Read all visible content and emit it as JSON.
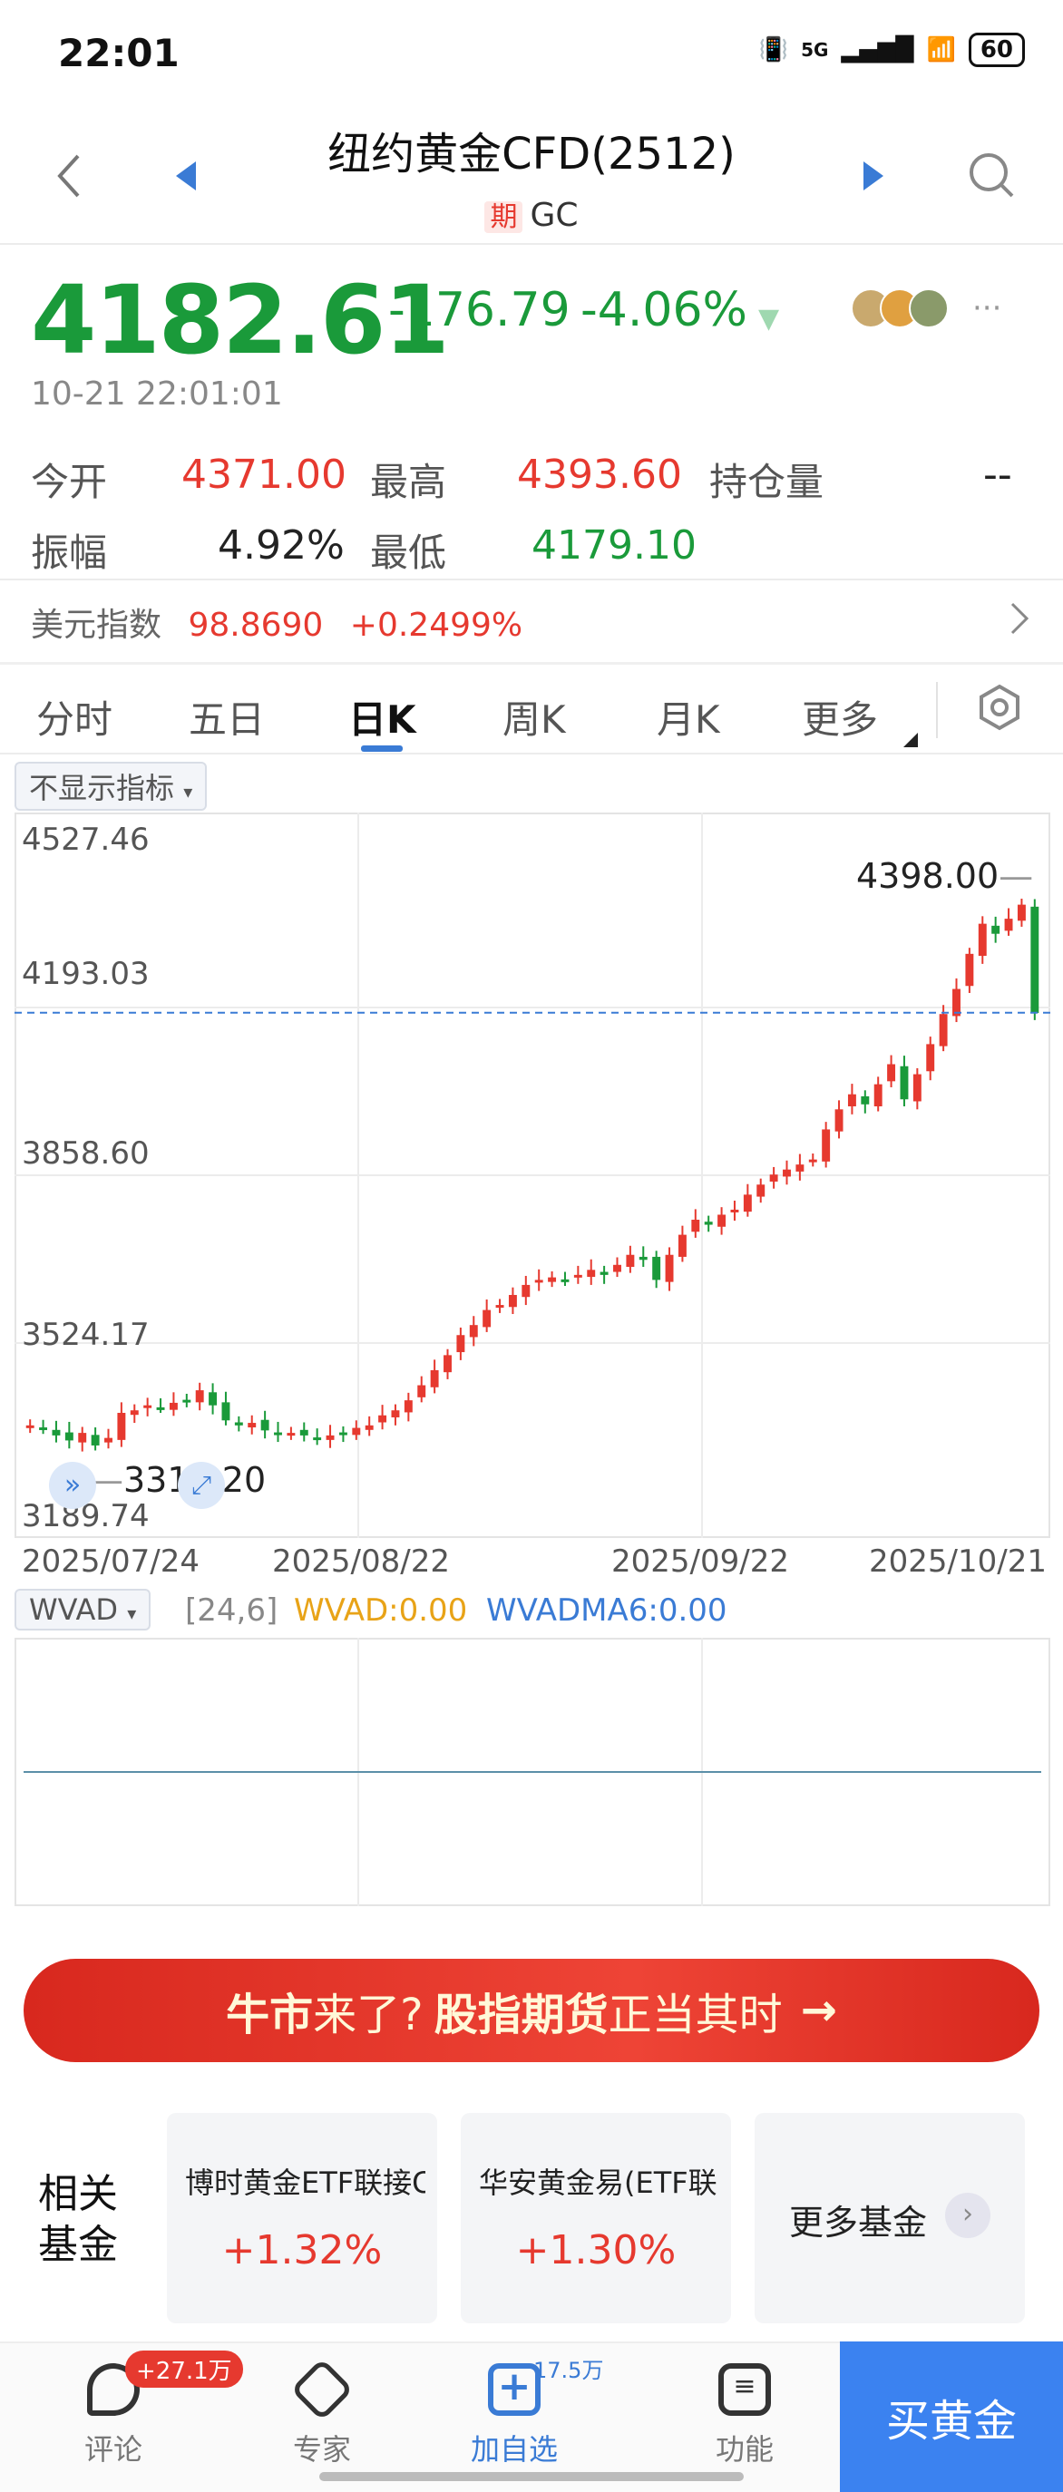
{
  "status_bar": {
    "time": "22:01",
    "network": "5G",
    "battery": "60"
  },
  "header": {
    "title": "纽约黄金CFD(2512)",
    "tag": "期",
    "code": "GC"
  },
  "quote": {
    "price": "4182.61",
    "change": "-176.79",
    "change_pct": "-4.06%",
    "timestamp": "10-21 22:01:01",
    "open_label": "今开",
    "open": "4371.00",
    "high_label": "最高",
    "high": "4393.60",
    "oi_label": "持仓量",
    "oi": "--",
    "amp_label": "振幅",
    "amp": "4.92%",
    "low_label": "最低",
    "low": "4179.10"
  },
  "usd_index": {
    "label": "美元指数",
    "value": "98.8690",
    "change": "+0.2499%"
  },
  "tabs": [
    {
      "label": "分时"
    },
    {
      "label": "五日"
    },
    {
      "label": "日K"
    },
    {
      "label": "周K"
    },
    {
      "label": "月K"
    },
    {
      "label": "更多"
    }
  ],
  "indicator_select": "不显示指标",
  "chart": {
    "y_ticks": [
      "4527.46",
      "4193.03",
      "3858.60",
      "3524.17",
      "3189.74"
    ],
    "x_ticks": [
      "2025/07/24",
      "2025/08/22",
      "2025/09/22",
      "2025/10/21"
    ],
    "max_label": "4398.00",
    "min_label": "3319.20",
    "current_line": 4182.61
  },
  "wvad": {
    "select": "WVAD",
    "params": "[24,6]",
    "wvad_label": "WVAD:0.00",
    "wvadma_label": "WVADMA6:0.00"
  },
  "banner": {
    "part1": "牛市",
    "part2": "来了?",
    "part3": "股指期货",
    "part4": "正当其时",
    "arrow": "→"
  },
  "funds": {
    "heading_1": "相关",
    "heading_2": "基金",
    "items": [
      {
        "name": "博时黄金ETF联接C",
        "pct": "+1.32%"
      },
      {
        "name": "华安黄金易(ETF联…",
        "pct": "+1.30%"
      }
    ],
    "more": "更多基金"
  },
  "bottom_nav": {
    "comment": "评论",
    "comment_badge": "+27.1万",
    "expert": "专家",
    "watch": "加自选",
    "watch_count": "17.5万",
    "function": "功能",
    "buy": "买黄金"
  },
  "colors": {
    "up": "#e6392f",
    "down": "#1a9a3a",
    "accent": "#3a7bd5"
  }
}
